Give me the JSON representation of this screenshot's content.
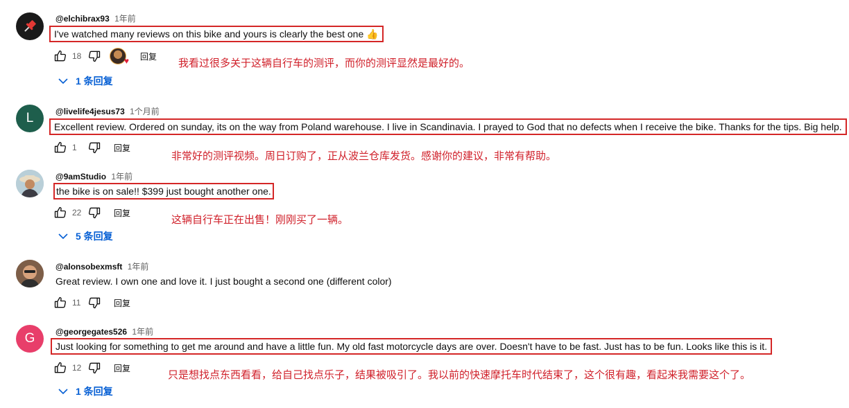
{
  "comments": [
    {
      "handle": "@elchibrax93",
      "time": "1年前",
      "avatar_icon": "pushpin-icon",
      "avatar_color": "#1a1a1a",
      "text": "I've watched many reviews on this bike and yours is clearly the best one 👍",
      "likes": "18",
      "reply_label": "回复",
      "creator_heart": true,
      "replies_label": "1 条回复",
      "translation": "我看过很多关于这辆自行车的测评，而你的测评显然是最好的。"
    },
    {
      "handle": "@livelife4jesus73",
      "time": "1个月前",
      "avatar_letter": "L",
      "avatar_color": "#1e5e4c",
      "text": "Excellent review. Ordered on sunday, its on the way from Poland warehouse. I live in Scandinavia.  I prayed to God that no defects  when I receive the bike. Thanks for the tips. Big help.",
      "likes": "1",
      "reply_label": "回复",
      "translation": "非常好的测评视频。周日订购了，正从波兰仓库发货。感谢你的建议，非常有帮助。"
    },
    {
      "handle": "@9amStudio",
      "time": "1年前",
      "avatar_icon": "user-photo-icon",
      "text": "the bike is on sale!! $399 just bought another one.",
      "likes": "22",
      "reply_label": "回复",
      "replies_label": "5 条回复",
      "translation": "这辆自行车正在出售！刚刚买了一辆。"
    },
    {
      "handle": "@alonsobexmsft",
      "time": "1年前",
      "avatar_icon": "user-photo-icon",
      "text": "Great review. I own one and love it. I just bought a second one (different color)",
      "likes": "11",
      "reply_label": "回复"
    },
    {
      "handle": "@georgegates526",
      "time": "1年前",
      "avatar_letter": "G",
      "avatar_color": "#e83e6a",
      "text": "Just looking for something to get me around and have a little fun. My old fast motorcycle days are over.  Doesn't have to be fast. Just has to be fun. Looks like this is it.",
      "likes": "12",
      "reply_label": "回复",
      "replies_label": "1 条回复",
      "translation": "只是想找点东西看看，给自己找点乐子，结果被吸引了。我以前的快速摩托车时代结束了，这个很有趣，看起来我需要这个了。"
    }
  ],
  "colors": {
    "highlight_border": "#d42626",
    "translation": "#d0202a",
    "replies_link": "#065fd4",
    "muted": "#606060"
  }
}
